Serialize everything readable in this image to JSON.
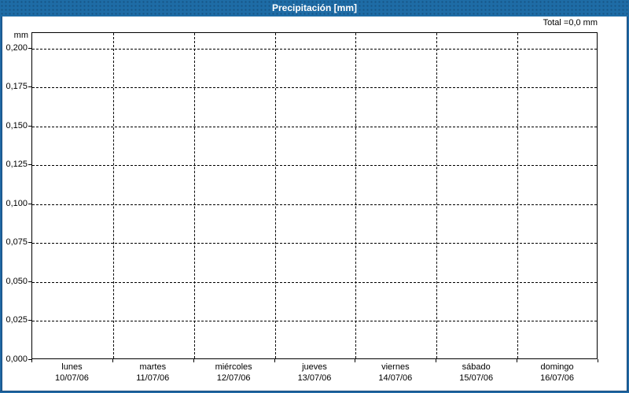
{
  "window": {
    "title": "Precipitación [mm]"
  },
  "chart_data": {
    "type": "line",
    "title": "Precipitación [mm]",
    "ylabel": "mm",
    "xlabel": "",
    "total_annotation": "Total =0,0 mm",
    "total_value_mm": 0.0,
    "ylim": [
      0,
      0.21
    ],
    "y_tick_step": 0.025,
    "y_tick_labels": [
      "0,000",
      "0,025",
      "0,050",
      "0,075",
      "0,100",
      "0,125",
      "0,150",
      "0,175",
      "0,200"
    ],
    "categories": [
      "lunes",
      "martes",
      "miércoles",
      "jueves",
      "viernes",
      "sábado",
      "domingo"
    ],
    "category_dates": [
      "10/07/06",
      "11/07/06",
      "12/07/06",
      "13/07/06",
      "14/07/06",
      "15/07/06",
      "16/07/06"
    ],
    "series": [
      {
        "name": "Precipitación",
        "values": [
          0,
          0,
          0,
          0,
          0,
          0,
          0
        ]
      }
    ],
    "grid": "dashed",
    "legend": "none"
  },
  "colors": {
    "titlebar": "#1E6CA6",
    "border": "#2068A4",
    "grid": "#000000",
    "plot_background": "#FFFFFF",
    "title_text": "#FFFFFF"
  }
}
